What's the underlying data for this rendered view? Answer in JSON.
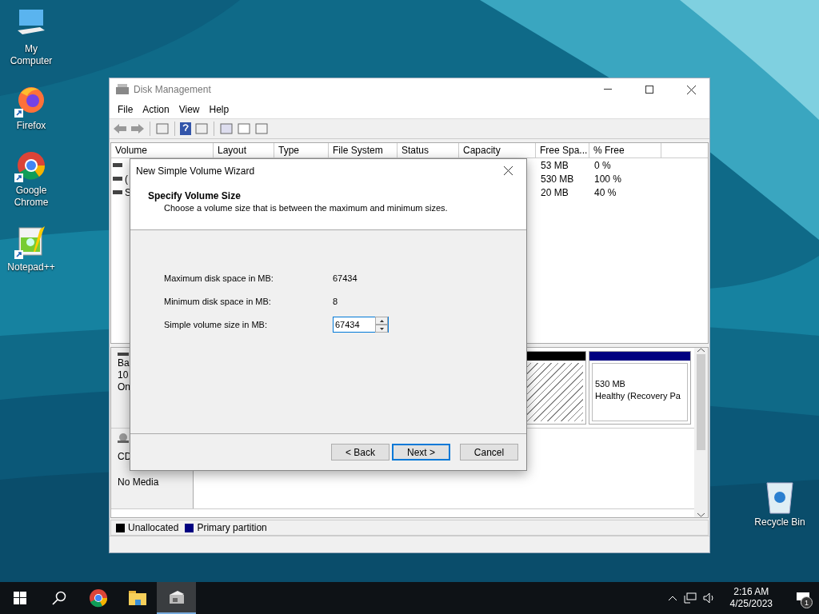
{
  "desktop_icons": [
    {
      "label": "My Computer",
      "kind": "computer",
      "shortcut": false
    },
    {
      "label": "Firefox",
      "kind": "firefox",
      "shortcut": true
    },
    {
      "label": "Google Chrome",
      "kind": "chrome",
      "shortcut": true
    },
    {
      "label": "Notepad++",
      "kind": "notepad",
      "shortcut": true
    }
  ],
  "recycle_bin": {
    "label": "Recycle Bin"
  },
  "window": {
    "title": "Disk Management",
    "menu": [
      "File",
      "Action",
      "View",
      "Help"
    ],
    "table": {
      "columns": [
        "Volume",
        "Layout",
        "Type",
        "File System",
        "Status",
        "Capacity",
        "Free Spa...",
        "% Free"
      ],
      "rows": [
        {
          "free_space": "53 MB",
          "percent_free": "0 %"
        },
        {
          "volume": "(",
          "free_space": "530 MB",
          "percent_free": "100 %"
        },
        {
          "volume": "S",
          "free_space": "20 MB",
          "percent_free": "40 %"
        }
      ]
    },
    "disks": [
      {
        "kind": "disk",
        "label_lines": [
          "Ba",
          "10",
          "On"
        ],
        "partitions": [
          {
            "kind": "unallocated"
          },
          {
            "kind": "primary",
            "lines": [
              "530 MB",
              "Healthy (Recovery Pa"
            ]
          }
        ]
      },
      {
        "kind": "cdrom",
        "label_lines": [
          "CD",
          "No Media"
        ]
      }
    ],
    "legend": [
      {
        "label": "Unallocated",
        "color": "#000000"
      },
      {
        "label": "Primary partition",
        "color": "#000080"
      }
    ]
  },
  "dialog": {
    "title": "New Simple Volume Wizard",
    "heading": "Specify Volume Size",
    "subheading": "Choose a volume size that is between the maximum and minimum sizes.",
    "fields": [
      {
        "label": "Maximum disk space in MB:",
        "value": "67434",
        "kind": "text"
      },
      {
        "label": "Minimum disk space in MB:",
        "value": "8",
        "kind": "text"
      },
      {
        "label": "Simple volume size in MB:",
        "value": "67434",
        "kind": "spin"
      }
    ],
    "buttons": [
      {
        "label": "< Back",
        "default": false
      },
      {
        "label": "Next >",
        "default": true
      },
      {
        "label": "Cancel",
        "default": false
      }
    ]
  },
  "taskbar": {
    "items": [
      {
        "kind": "start",
        "active": false
      },
      {
        "kind": "search",
        "active": false
      },
      {
        "kind": "chrome",
        "active": false
      },
      {
        "kind": "explorer",
        "active": false
      },
      {
        "kind": "diskmgmt",
        "active": true
      }
    ],
    "time": "2:16 AM",
    "date": "4/25/2023",
    "notification_count": "1"
  }
}
